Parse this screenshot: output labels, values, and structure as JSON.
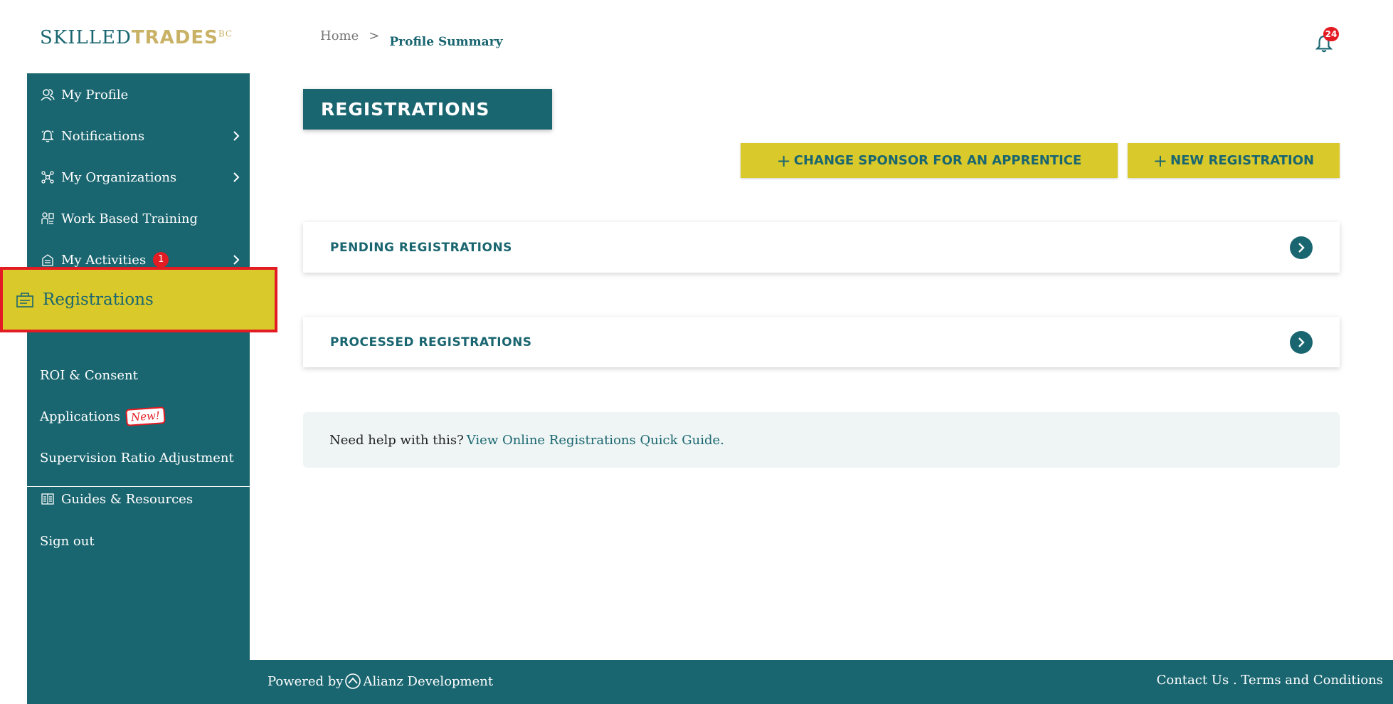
{
  "header": {
    "logo": {
      "word1": "SKILLED",
      "word2": "TRADES",
      "suffix": "BC"
    },
    "breadcrumb": {
      "home": "Home",
      "separator": ">",
      "current": "Profile Summary"
    },
    "notifications_count": "24"
  },
  "sidebar": {
    "items": [
      {
        "label": "My Profile",
        "icon": "user-icon"
      },
      {
        "label": "Notifications",
        "icon": "bell-icon"
      },
      {
        "label": "My Organizations",
        "icon": "network-icon"
      },
      {
        "label": "Work Based Training",
        "icon": "training-icon"
      },
      {
        "label": "My Activities",
        "icon": "activities-icon",
        "badge": "1"
      },
      {
        "label": "Registrations",
        "icon": "registrations-icon"
      },
      {
        "label": "ROI & Consent"
      },
      {
        "label": "Applications",
        "badge": "New!"
      },
      {
        "label": "Supervision Ratio Adjustment"
      },
      {
        "label": "Guides & Resources",
        "icon": "book-icon"
      },
      {
        "label": "Sign out"
      }
    ]
  },
  "main": {
    "title": "REGISTRATIONS",
    "buttons": {
      "change_sponsor_plus": "+",
      "change_sponsor": "CHANGE SPONSOR FOR AN APPRENTICE",
      "new_registration_plus": "+",
      "new_registration": "NEW REGISTRATION"
    },
    "sections": {
      "pending": "PENDING REGISTRATIONS",
      "processed": "PROCESSED REGISTRATIONS"
    },
    "help": {
      "text": "Need help with this?",
      "link": "View Online Registrations Quick Guide."
    }
  },
  "footer": {
    "powered_by": "Powered by",
    "company": "Alianz Development",
    "contact": "Contact Us",
    "separator": " . ",
    "terms": "Terms and Conditions"
  },
  "colors": {
    "primary": "#1a6670",
    "accent": "#d9c92b",
    "alert": "#e31b23",
    "help_bg": "#eef5f4"
  }
}
